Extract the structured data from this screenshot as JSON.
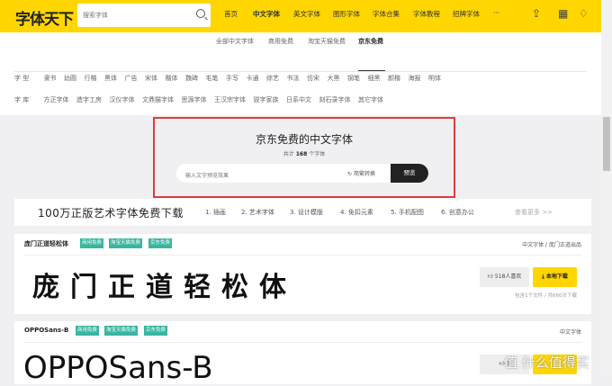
{
  "header": {
    "logo": "字体天下",
    "search_placeholder": "搜索字体",
    "nav": [
      "首页",
      "中文字体",
      "英文字体",
      "图形字体",
      "字体合集",
      "字体教程",
      "招牌字体",
      "···"
    ],
    "icons": [
      "upload-icon",
      "qr-code-icon",
      "bell-icon"
    ]
  },
  "subnav": [
    "全部中文字体",
    "商用免费",
    "淘宝天猫免费",
    "京东免费"
  ],
  "filters": {
    "type_label": "字 型",
    "types": [
      "隶书",
      "幼圆",
      "行楷",
      "黑体",
      "广告",
      "宋体",
      "楷体",
      "魏碑",
      "毛笔",
      "手写",
      "卡通",
      "综艺",
      "书法",
      "仿宋",
      "大黑",
      "钢笔",
      "细黑",
      "颜楷",
      "海报",
      "明体"
    ],
    "lib_label": "字 库",
    "libs": [
      "方正字体",
      "造字工房",
      "汉仪字体",
      "文鼎猫字体",
      "思源字体",
      "王汉宗字体",
      "锐字家族",
      "日系中文",
      "刻石录字体",
      "其它字体"
    ]
  },
  "hero": {
    "title": "京东免费的中文字体",
    "count_prefix": "共计",
    "count": "168",
    "count_suffix": "个字体",
    "input_placeholder": "输入文字预览效果",
    "convert": "简繁转换",
    "preview": "预览"
  },
  "banner": {
    "title": "100万正版艺术字体免费下载",
    "links": [
      "1. 插画",
      "2. 艺术字体",
      "3. 设计模版",
      "4. 免扣元素",
      "5. 手机配图",
      "6. 创意办公",
      "查看更多 >>"
    ]
  },
  "cards": [
    {
      "name": "庞门正道轻松体",
      "tags": [
        "商用免费",
        "淘宝天猫免费",
        "京东免费"
      ],
      "category": "中文字体",
      "publisher": "庞门正道出品",
      "preview": "庞门正道轻松体",
      "likes": "518人喜欢",
      "download": "本地下载",
      "meta": "包含1个文件 / 共660次下载"
    },
    {
      "name": "OPPOSans-B",
      "tags": [
        "商用免费",
        "淘宝天猫免费",
        "京东免费"
      ],
      "category": "中文字体",
      "preview": "OPPOSans-B",
      "likes": "3"
    }
  ],
  "watermark": "值 什么值得买",
  "colors": {
    "brand": "#ffd600",
    "tag": "#3ab5a0",
    "highlight": "#e03c3c"
  }
}
